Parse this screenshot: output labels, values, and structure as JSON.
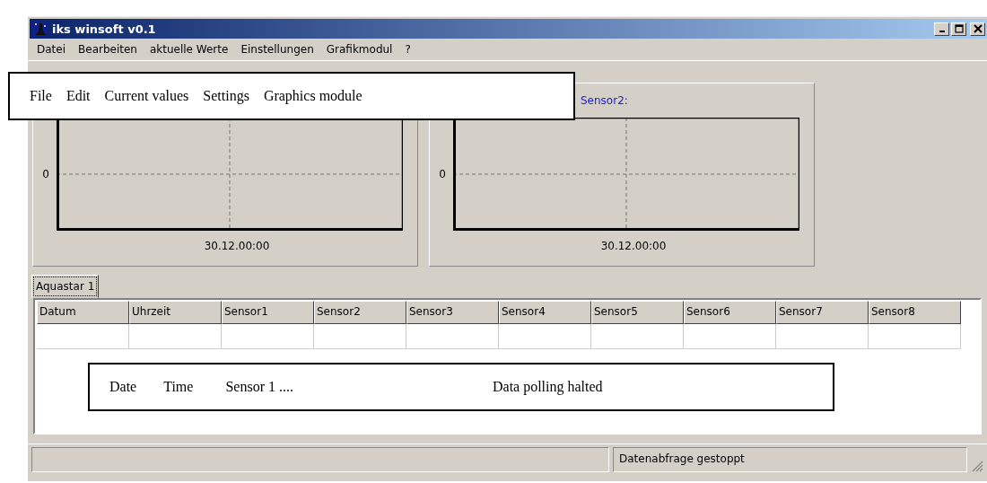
{
  "window": {
    "title": "iks winsoft v0.1"
  },
  "menu": [
    "Datei",
    "Bearbeiten",
    "aktuelle Werte",
    "Einstellungen",
    "Grafikmodul",
    "?"
  ],
  "charts": [
    {
      "y_tick": "0",
      "x_tick": "30.12.00:00"
    },
    {
      "title": "Sensor2:",
      "y_tick": "0",
      "x_tick": "30.12.00:00"
    }
  ],
  "tabs": [
    {
      "label": "Aquastar 1",
      "selected": true
    }
  ],
  "table": {
    "columns": [
      "Datum",
      "Uhrzeit",
      "Sensor1",
      "Sensor2",
      "Sensor3",
      "Sensor4",
      "Sensor5",
      "Sensor6",
      "Sensor7",
      "Sensor8"
    ]
  },
  "status_bar": {
    "message": "Datenabfrage gestoppt"
  },
  "annotations": [
    {
      "words": [
        "File",
        "Edit",
        "Current values",
        "Settings",
        "Graphics module"
      ]
    },
    {
      "words": [
        "Date",
        "Time",
        "Sensor 1 ....",
        "Data polling halted"
      ]
    }
  ]
}
